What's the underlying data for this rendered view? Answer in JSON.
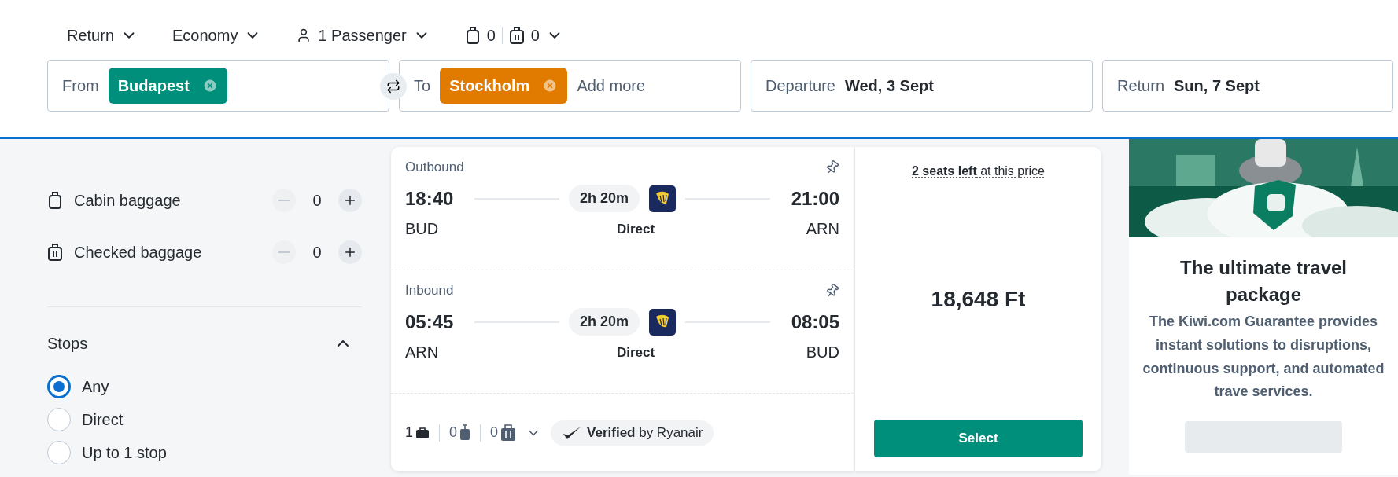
{
  "trip_options": [
    {
      "kind": "plain",
      "label": "Return"
    },
    {
      "kind": "plain",
      "label": "Economy"
    },
    {
      "kind": "passenger",
      "label": "1 Passenger"
    }
  ],
  "bag_summary": {
    "cabin": "0",
    "checked": "0"
  },
  "search": {
    "from": {
      "label": "From",
      "chips": [
        {
          "text": "Budapest",
          "color": "#008f7a"
        }
      ]
    },
    "to": {
      "label": "To",
      "chips": [
        {
          "text": "Stockholm",
          "color": "#e07b00"
        }
      ],
      "placeholder": "Add more"
    },
    "dates": [
      {
        "label": "Departure",
        "value": "Wed, 3 Sept"
      },
      {
        "label": "Return",
        "value": "Sun, 7 Sept"
      }
    ]
  },
  "filters": {
    "baggage": [
      {
        "kind": "cabin",
        "name": "Cabin baggage",
        "count": "0",
        "decrease_disabled": true
      },
      {
        "kind": "checked",
        "name": "Checked baggage",
        "count": "0",
        "decrease_disabled": true
      }
    ],
    "stops": {
      "title": "Stops",
      "expanded": true,
      "options": [
        {
          "label": "Any",
          "selected": true
        },
        {
          "label": "Direct",
          "selected": false
        },
        {
          "label": "Up to 1 stop",
          "selected": false
        }
      ]
    }
  },
  "itinerary": {
    "segments": [
      {
        "label": "Outbound",
        "dep_time": "18:40",
        "arr_time": "21:00",
        "dep_code": "BUD",
        "arr_code": "ARN",
        "duration": "2h 20m",
        "stops": "Direct"
      },
      {
        "label": "Inbound",
        "dep_time": "05:45",
        "arr_time": "08:05",
        "dep_code": "ARN",
        "arr_code": "BUD",
        "duration": "2h 20m",
        "stops": "Direct"
      }
    ],
    "bags": [
      {
        "kind": "personal",
        "count": "1"
      },
      {
        "kind": "cabin",
        "count": "0"
      },
      {
        "kind": "checked",
        "count": "0"
      }
    ],
    "verified": "**Verified** by Ryanair"
  },
  "price": {
    "seats_note": "**2 seats left** at this price",
    "amount": "18,648 Ft",
    "button": "Select"
  },
  "promo": {
    "title": "The ultimate travel package",
    "text": "The Kiwi.com Guarantee provides instant solutions to disruptions, continuous support, and automated trave services."
  }
}
